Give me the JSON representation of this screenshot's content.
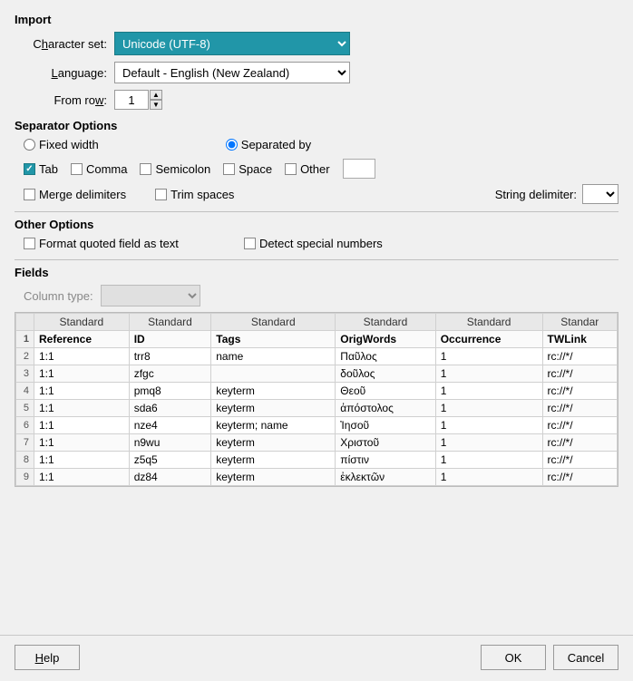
{
  "dialog": {
    "title": "Import"
  },
  "import": {
    "section_label": "Import",
    "charset_label": "C̲haracter set:",
    "charset_value": "Unicode (UTF-8)",
    "language_label": "L̲anguage:",
    "language_value": "Default - English (New Zealand)",
    "fromrow_label": "From ro̲w:",
    "fromrow_value": "1"
  },
  "separator": {
    "section_label": "Separator Options",
    "fixed_width_label": "Fixed width",
    "separated_by_label": "S̲eparated by",
    "tab_label": "T̲ab",
    "comma_label": "Comma",
    "semicolon_label": "S̲emicolon",
    "space_label": "Space",
    "other_label": "Other",
    "merge_delimiters_label": "Merge delimiters",
    "trim_spaces_label": "Tri̲m spaces",
    "string_delimiter_label": "String delimiter:"
  },
  "other_options": {
    "section_label": "Other Options",
    "format_quoted_label": "F̲ormat quoted field as text",
    "detect_special_label": "Detect special n̲umbers"
  },
  "fields": {
    "section_label": "Fields",
    "column_type_label": "Column type:"
  },
  "table": {
    "header_row": [
      "",
      "Standard",
      "Standard",
      "Standard",
      "Standard",
      "Standard",
      "Standar"
    ],
    "col_names": [
      "",
      "Reference",
      "ID",
      "Tags",
      "OrigWords",
      "Occurrence",
      "TWLink"
    ],
    "rows": [
      [
        "2",
        "1:1",
        "trr8",
        "name",
        "Παῦλος",
        "1",
        "rc://*/ "
      ],
      [
        "3",
        "1:1",
        "zfgc",
        "",
        "δοῦλος",
        "1",
        "rc://*/ "
      ],
      [
        "4",
        "1:1",
        "pmq8",
        "keyterm",
        "Θεοῦ",
        "1",
        "rc://*/ "
      ],
      [
        "5",
        "1:1",
        "sda6",
        "keyterm",
        "ἀπόστολος",
        "1",
        "rc://*/ "
      ],
      [
        "6",
        "1:1",
        "nze4",
        "keyterm; name",
        "Ἰησοῦ",
        "1",
        "rc://*/ "
      ],
      [
        "7",
        "1:1",
        "n9wu",
        "keyterm",
        "Χριστοῦ",
        "1",
        "rc://*/ "
      ],
      [
        "8",
        "1:1",
        "z5q5",
        "keyterm",
        "πίστιν",
        "1",
        "rc://*/ "
      ],
      [
        "9",
        "1:1",
        "dz84",
        "keyterm",
        "ἐκλεκτῶν",
        "1",
        "rc://*/ "
      ]
    ]
  },
  "buttons": {
    "help_label": "H̲elp",
    "ok_label": "OK",
    "cancel_label": "Cancel"
  }
}
